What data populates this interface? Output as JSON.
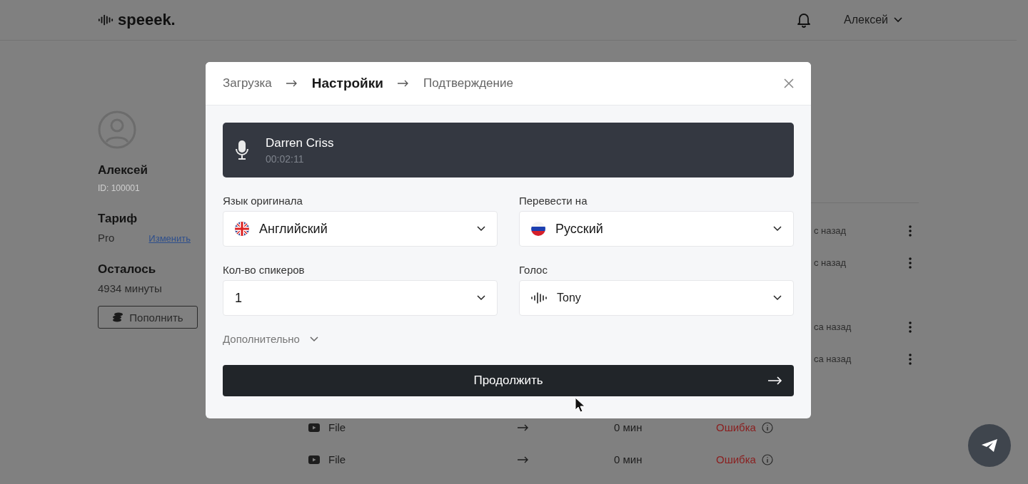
{
  "header": {
    "logo": "speeek.",
    "user": "Алексей"
  },
  "profile": {
    "name": "Алексей",
    "id": "ID: 100001",
    "plan_label": "Тариф",
    "plan": "Pro",
    "change_link": "Изменить",
    "remaining_label": "Осталось",
    "remaining": "4934 минуты",
    "topup_button": "Пополнить"
  },
  "file_groups": [
    [
      {
        "time": "с назад"
      },
      {
        "time": "с назад"
      }
    ],
    [
      {
        "time": "са назад"
      },
      {
        "time": "са назад"
      }
    ],
    [
      {
        "name": "File",
        "duration": "0 мин",
        "status": "Ошибка"
      },
      {
        "name": "File",
        "duration": "0 мин",
        "status": "Ошибка"
      }
    ]
  ],
  "modal": {
    "steps": [
      {
        "label": "Загрузка",
        "selected": false
      },
      {
        "label": "Настройки",
        "selected": true
      },
      {
        "label": "Подтверждение",
        "selected": false
      }
    ],
    "recording": {
      "title": "Darren Criss",
      "duration": "00:02:11"
    },
    "fields": [
      {
        "label": "Язык оригинала",
        "value": "Английский",
        "kind": "flag_uk"
      },
      {
        "label": "Перевести на",
        "value": "Русский",
        "kind": "flag_ru"
      },
      {
        "label": "Кол-во спикеров",
        "value": "1",
        "kind": "plain"
      },
      {
        "label": "Голос",
        "value": "Tony",
        "kind": "voice"
      }
    ],
    "advanced": {
      "label": "Дополнительно",
      "expanded": false
    },
    "continue_button": "Продолжить"
  }
}
